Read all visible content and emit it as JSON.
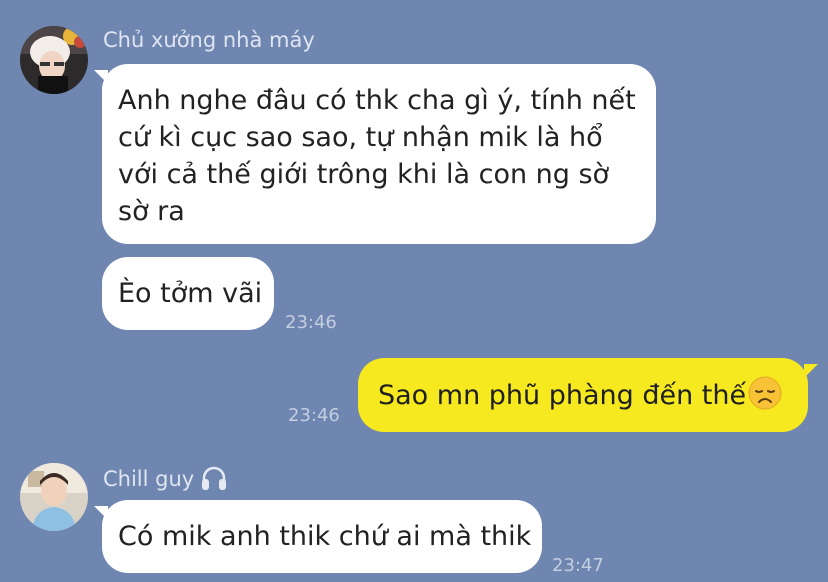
{
  "messages": [
    {
      "sender": "Chủ xưởng nhà máy",
      "bubbles": [
        {
          "lines": [
            "Anh nghe đâu có thk cha gì ý, tính nết",
            "cứ kì cục sao sao, tự nhận mik là hổ",
            "với cả thế giới trông khi là con ng sờ",
            "sờ ra"
          ]
        },
        {
          "lines": [
            "Èo tởm vãi"
          ],
          "time": "23:46"
        }
      ]
    },
    {
      "outgoing": true,
      "text": "Sao mn phũ phàng đến thế",
      "emoji": "disappointed-face-icon",
      "time": "23:46"
    },
    {
      "sender": "Chill guy",
      "sender_icon": "headphones-icon",
      "bubbles": [
        {
          "lines": [
            "Có mik anh thik chứ ai mà thik"
          ],
          "time": "23:47"
        }
      ]
    }
  ],
  "colors": {
    "background": "#6f86b1",
    "incoming_bubble": "#ffffff",
    "outgoing_bubble": "#f6e91f",
    "timestamp": "#c4cee1",
    "sender_name": "#dfe5f0"
  }
}
